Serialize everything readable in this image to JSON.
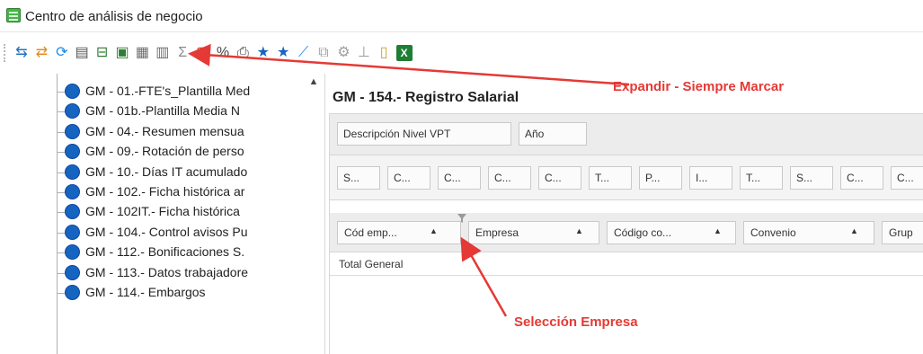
{
  "window": {
    "title": "Centro de análisis de negocio"
  },
  "toolbar": {
    "icons": [
      {
        "name": "export-icon",
        "glyph": "⇆",
        "color": "#1e6fc4"
      },
      {
        "name": "import-icon",
        "glyph": "⇄",
        "color": "#e08b1d"
      },
      {
        "name": "refresh-icon",
        "glyph": "⟳",
        "color": "#1e88e5"
      },
      {
        "name": "list-icon",
        "glyph": "▤",
        "color": "#555555"
      },
      {
        "name": "tree-structure-icon",
        "glyph": "⊟",
        "color": "#2e7d32"
      },
      {
        "name": "expand-icon",
        "glyph": "▣",
        "color": "#2e7d32"
      },
      {
        "name": "calendar-icon",
        "glyph": "▦",
        "color": "#6d6d6d"
      },
      {
        "name": "grid-icon",
        "glyph": "▥",
        "color": "#6d6d6d"
      },
      {
        "name": "sum-icon",
        "glyph": "Σ",
        "color": "#8a8a8a"
      },
      {
        "name": "document-icon",
        "glyph": "▢",
        "color": "#c62828"
      },
      {
        "name": "percent-icon",
        "glyph": "%",
        "color": "#444444"
      },
      {
        "name": "print-icon",
        "glyph": "⎙",
        "color": "#444444"
      },
      {
        "name": "star-icon",
        "glyph": "★",
        "color": "#1565c0"
      },
      {
        "name": "star-remove-icon",
        "glyph": "★",
        "color": "#1565c0"
      },
      {
        "name": "chart-icon",
        "glyph": "⟋",
        "color": "#1e88e5"
      },
      {
        "name": "copy-icon",
        "glyph": "⧉",
        "color": "#9e9e9e"
      },
      {
        "name": "hierarchy-icon",
        "glyph": "⚙",
        "color": "#9e9e9e"
      },
      {
        "name": "network-icon",
        "glyph": "⊥",
        "color": "#9e9e9e"
      },
      {
        "name": "clipboard-icon",
        "glyph": "▯",
        "color": "#c9a227"
      },
      {
        "name": "excel-icon",
        "glyph": "X",
        "color": "#1e7e34"
      }
    ]
  },
  "tree": {
    "items": [
      "GM - 01.-FTE's_Plantilla Med",
      "GM - 01b.-Plantilla Media N",
      "GM - 04.- Resumen mensua",
      "GM - 09.- Rotación de perso",
      "GM - 10.- Días IT acumulado",
      "GM - 102.- Ficha histórica ar",
      "GM - 102IT.- Ficha histórica",
      "GM - 104.- Control avisos Pu",
      "GM - 112.- Bonificaciones S.",
      "GM - 113.- Datos trabajadore",
      "GM - 114.- Embargos"
    ],
    "scroll_up": "▲"
  },
  "report": {
    "title": "GM - 154.- Registro Salarial",
    "filter_fields": [
      "Descripción Nivel VPT",
      "Año"
    ],
    "column_fields": [
      "S...",
      "C...",
      "C...",
      "C...",
      "C...",
      "T...",
      "P...",
      "I...",
      "T...",
      "S...",
      "C...",
      "C..."
    ],
    "row_fields": [
      {
        "label": "Cód emp...",
        "arrow": "▲"
      },
      {
        "label": "Empresa",
        "arrow": "▲"
      },
      {
        "label": "Código co...",
        "arrow": "▲"
      },
      {
        "label": "Convenio",
        "arrow": "▲"
      },
      {
        "label": "Grup",
        "arrow": ""
      }
    ],
    "total_label": "Total General"
  },
  "annotations": {
    "expand": "Expandir - Siempre Marcar",
    "company": "Selección Empresa",
    "color": "#e53935"
  }
}
